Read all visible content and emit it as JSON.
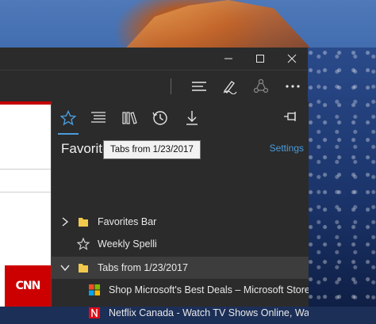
{
  "titlebar": {
    "minimize_icon": "minimize-icon",
    "maximize_icon": "maximize-icon",
    "close_icon": "close-icon"
  },
  "toolbar": {
    "icons": [
      "hub-icon",
      "web-note-icon",
      "share-icon",
      "more-icon"
    ]
  },
  "page_behind": {
    "brand": "CNN"
  },
  "hub": {
    "tabs": [
      "star-icon",
      "reading-list-icon",
      "books-icon",
      "history-icon",
      "download-icon"
    ],
    "active_tab": "favorites",
    "title": "Favorites",
    "settings_label": "Settings",
    "items": [
      {
        "label": "Favorites Bar",
        "type": "folder",
        "expanded": false
      },
      {
        "label": "Weekly Spelli",
        "type": "favorite"
      },
      {
        "label": "Tabs from 1/23/2017",
        "type": "folder",
        "expanded": true
      },
      {
        "label": "Shop Microsoft's Best Deals – Microsoft Store Ca",
        "type": "link",
        "indent": true
      },
      {
        "label": "Netflix Canada - Watch TV Shows Online, Watch I",
        "type": "link",
        "indent": true
      }
    ],
    "tooltip": "Tabs from 1/23/2017"
  },
  "colors": {
    "accent": "#4a9bdc",
    "panel": "#2b2b2b",
    "selected_row": "#3d3d3d",
    "folder": "#f2c94c",
    "netflix": "#e50914"
  }
}
